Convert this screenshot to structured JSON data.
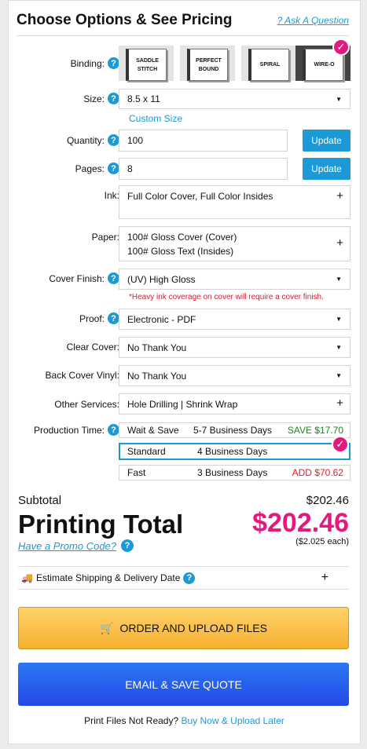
{
  "header": {
    "title": "Choose Options & See Pricing",
    "ask": "? Ask A Question"
  },
  "binding": {
    "label": "Binding:",
    "options": [
      "SADDLE STITCH",
      "PERFECT BOUND",
      "SPIRAL",
      "WIRE-O"
    ],
    "selected": "WIRE-O"
  },
  "size": {
    "label": "Size:",
    "value": "8.5 x 11",
    "custom": "Custom Size"
  },
  "quantity": {
    "label": "Quantity:",
    "value": "100",
    "button": "Update"
  },
  "pages": {
    "label": "Pages:",
    "value": "8",
    "button": "Update"
  },
  "ink": {
    "label": "Ink:",
    "value": "Full Color Cover, Full Color Insides"
  },
  "paper": {
    "label": "Paper:",
    "line1": "100# Gloss Cover (Cover)",
    "line2": "100# Gloss Text (Insides)"
  },
  "cover_finish": {
    "label": "Cover Finish:",
    "value": "(UV) High Gloss",
    "warning": "*Heavy ink coverage on cover will require a cover finish."
  },
  "proof": {
    "label": "Proof:",
    "value": "Electronic - PDF"
  },
  "clear_cover": {
    "label": "Clear Cover:",
    "value": "No Thank You"
  },
  "back_cover_vinyl": {
    "label": "Back Cover Vinyl:",
    "value": "No Thank You"
  },
  "other_services": {
    "label": "Other Services:",
    "value": "Hole Drilling | Shrink Wrap"
  },
  "production": {
    "label": "Production Time:",
    "options": [
      {
        "name": "Wait & Save",
        "days": "5-7 Business Days",
        "price": "SAVE $17.70",
        "color": "#1a8a1a"
      },
      {
        "name": "Standard",
        "days": "4 Business Days",
        "price": "",
        "color": "#111111"
      },
      {
        "name": "Fast",
        "days": "3 Business Days",
        "price": "ADD $70.62",
        "color": "#e0192e"
      }
    ],
    "selected": "Standard"
  },
  "totals": {
    "subtotal_label": "Subtotal",
    "subtotal": "$202.46",
    "total_label": "Printing Total",
    "total": "$202.46",
    "each": "($2.025 each)",
    "promo": "Have a Promo Code?"
  },
  "shipping": {
    "label": "Estimate Shipping & Delivery Date"
  },
  "actions": {
    "order": "ORDER AND UPLOAD FILES",
    "quote": "EMAIL & SAVE QUOTE"
  },
  "footer": {
    "text": "Print Files Not Ready?",
    "link": "Buy Now & Upload Later"
  },
  "colors": {
    "accent": "#1b9ad6",
    "pink": "#e5197d",
    "order": "#f6b031",
    "quote": "#2449e8"
  }
}
